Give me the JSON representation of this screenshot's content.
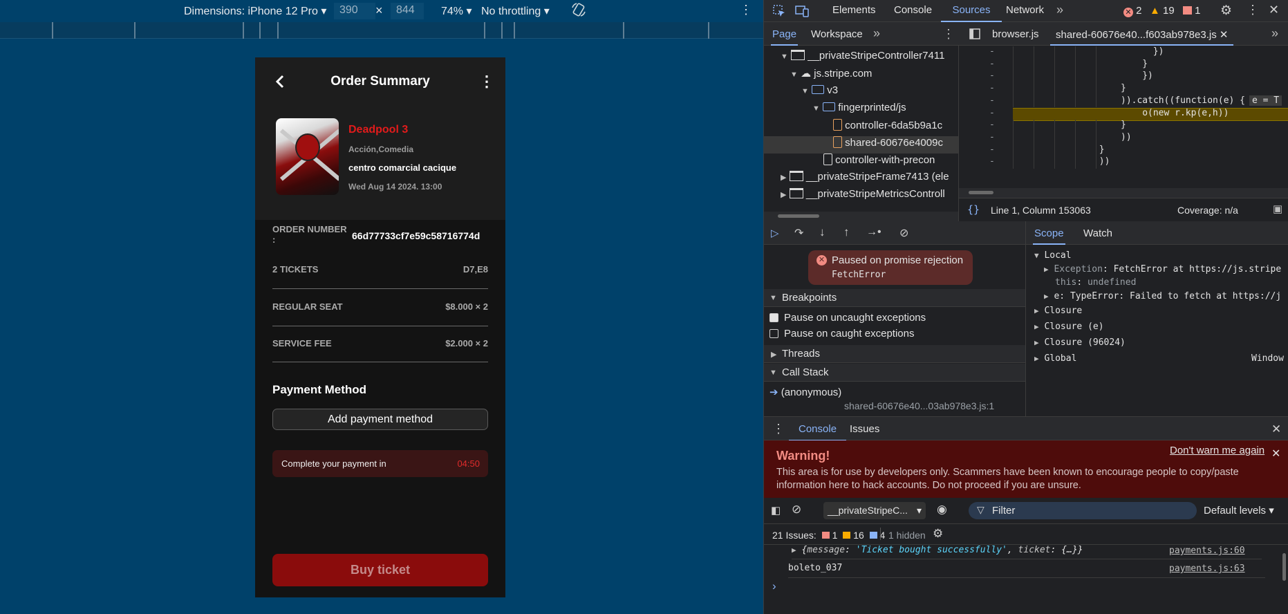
{
  "emulation": {
    "device_label": "Dimensions: iPhone 12 Pro",
    "width_value": "390",
    "times": "×",
    "height_value": "844",
    "zoom": "74%",
    "throttle": "No throttling"
  },
  "phone": {
    "header_title": "Order Summary",
    "movie": {
      "title": "Deadpool 3",
      "genre": "Acción,Comedia",
      "place": "centro comarcial cacique",
      "datetime": "Wed Aug 14 2024. 13:00"
    },
    "order_number_label": "ORDER NUMBER",
    "order_number_colon": ":",
    "order_number_value": "66d77733cf7e59c58716774d",
    "rows": [
      {
        "label": "2 TICKETS",
        "value": "D7,E8"
      },
      {
        "label": "REGULAR SEAT",
        "value": "$8.000 × 2"
      },
      {
        "label": "SERVICE FEE",
        "value": "$2.000 × 2"
      }
    ],
    "payment_heading": "Payment Method",
    "add_payment_label": "Add payment method",
    "timer_label": "Complete your payment in",
    "timer_value": "04:50",
    "buy_label": "Buy ticket"
  },
  "devtools": {
    "main_tabs": [
      "Elements",
      "Console",
      "Sources",
      "Network"
    ],
    "active_tab": "Sources",
    "counts": {
      "errors": "2",
      "warnings": "19",
      "issues": "1"
    },
    "nav_tabs": [
      "Page",
      "Workspace"
    ],
    "file_tabs": [
      "browser.js",
      "shared-60676e40...f603ab978e3.js"
    ],
    "tree": [
      {
        "label": "__privateStripeController7411",
        "type": "window",
        "indent": 1,
        "expanded": true
      },
      {
        "label": "js.stripe.com",
        "type": "cloud",
        "indent": 2,
        "expanded": true
      },
      {
        "label": "v3",
        "type": "folder",
        "indent": 3,
        "expanded": true
      },
      {
        "label": "fingerprinted/js",
        "type": "folder",
        "indent": 4,
        "expanded": true
      },
      {
        "label": "controller-6da5b9a1c",
        "type": "file-orange",
        "indent": 5
      },
      {
        "label": "shared-60676e4009c",
        "type": "file-orange",
        "indent": 5,
        "selected": true
      },
      {
        "label": "controller-with-precon",
        "type": "file-white",
        "indent": 4
      },
      {
        "label": "__privateStripeFrame7413 (ele",
        "type": "window",
        "indent": 1,
        "expanded": false
      },
      {
        "label": "__privateStripeMetricsControll",
        "type": "window",
        "indent": 1,
        "expanded": false
      }
    ],
    "code_lines": [
      {
        "text": "})",
        "indent": 13
      },
      {
        "text": "}",
        "indent": 12
      },
      {
        "text": "})",
        "indent": 12
      },
      {
        "text": "}",
        "indent": 10
      },
      {
        "text": ")).catch((function(e) {",
        "indent": 10,
        "hint": "e = T"
      },
      {
        "text": "o(new r.kp(e,h))",
        "indent": 12,
        "highlight": true
      },
      {
        "text": "}",
        "indent": 10
      },
      {
        "text": "))",
        "indent": 10
      },
      {
        "text": "}",
        "indent": 8
      },
      {
        "text": "))",
        "indent": 8
      }
    ],
    "status_position": "Line 1, Column 153063",
    "status_coverage": "Coverage: n/a",
    "paused_title": "Paused on promise rejection",
    "paused_error": "FetchError",
    "breakpoints_label": "Breakpoints",
    "bp_uncaught": "Pause on uncaught exceptions",
    "bp_caught": "Pause on caught exceptions",
    "threads_label": "Threads",
    "callstack_label": "Call Stack",
    "callstack_fn": "(anonymous)",
    "callstack_loc": "shared-60676e40...03ab978e3.js:1",
    "scope_tabs": [
      "Scope",
      "Watch"
    ],
    "scope": [
      {
        "label": "Local",
        "expanded": true,
        "level": 0
      },
      {
        "key": "Exception",
        "value": "FetchError at https://js.stripe",
        "level": 1,
        "expandable": true
      },
      {
        "key": "this",
        "value": "undefined",
        "level": 1,
        "dim": true
      },
      {
        "key": "e",
        "value": "TypeError: Failed to fetch at https://j",
        "level": 1,
        "expandable": true
      },
      {
        "label": "Closure",
        "level": 0
      },
      {
        "label": "Closure (e)",
        "level": 0
      },
      {
        "label": "Closure (96024)",
        "level": 0
      },
      {
        "label": "Global",
        "value": "Window",
        "level": 0
      }
    ],
    "drawer_tabs": [
      "Console",
      "Issues"
    ],
    "warning_title": "Warning!",
    "warning_dismiss": "Don't warn me again",
    "warning_text_1": "This area is for use by developers only. Scammers have been known to encourage people to copy/paste",
    "warning_text_2": "information here to hack accounts. Do not proceed if you are unsure.",
    "context_select": "__privateStripeC...",
    "filter_placeholder": "Filter",
    "levels": "Default levels",
    "issues_label": "21 Issues:",
    "issues_counts": {
      "errors": "1",
      "warnings": "16",
      "info": "4"
    },
    "hidden_label": "1 hidden",
    "log": [
      {
        "text_key": "message",
        "text_val": "'Ticket bought successfully'",
        "text_key2": "ticket",
        "text_val2": "{…}",
        "src": "payments.js:60"
      },
      {
        "text": "boleto_037",
        "src": "payments.js:63"
      }
    ],
    "prompt": "›"
  }
}
